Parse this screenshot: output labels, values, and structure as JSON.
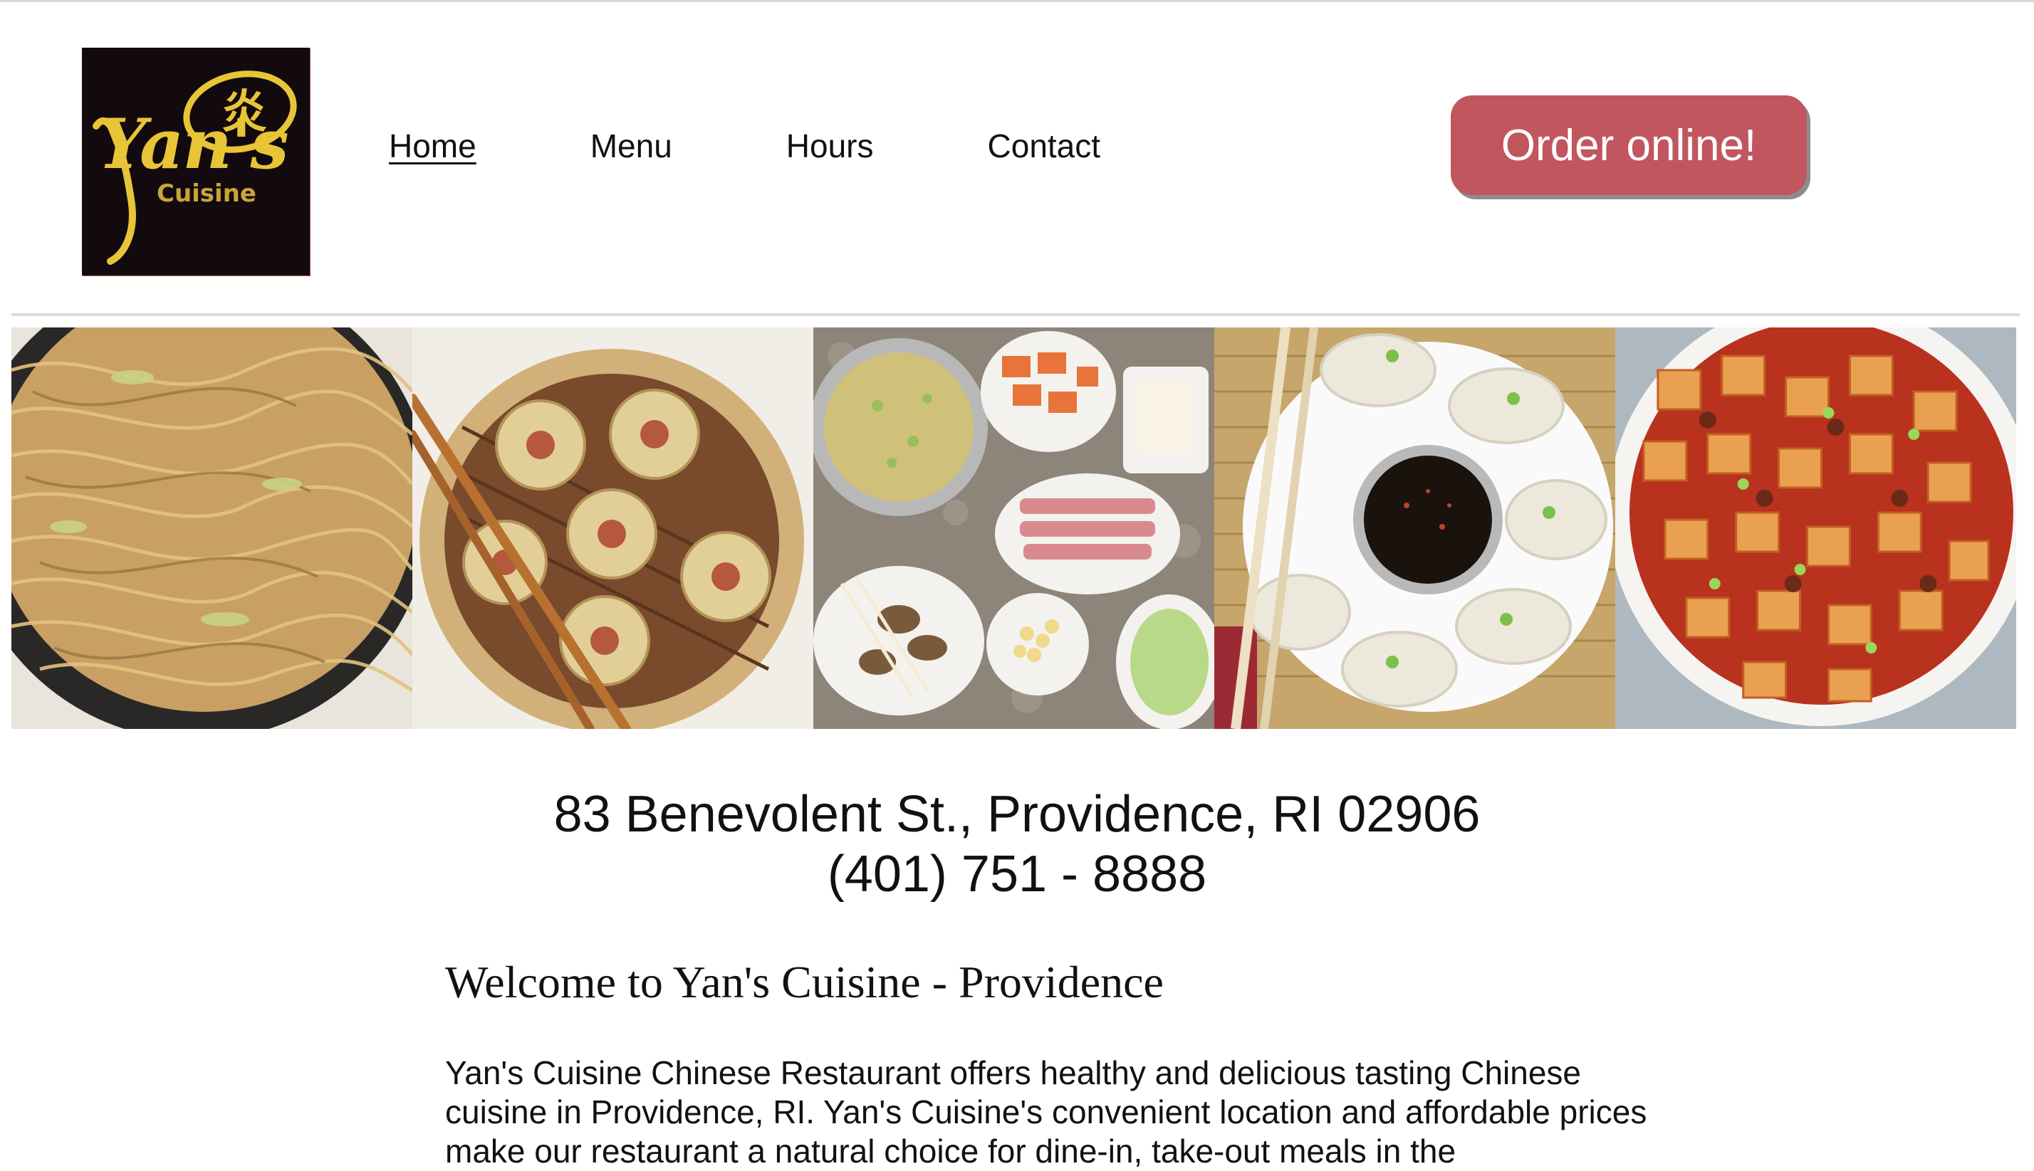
{
  "logo": {
    "brand_text": "Yan's",
    "sub_text": "Cuisine",
    "mark_text": "炎"
  },
  "nav": {
    "items": [
      {
        "label": "Home",
        "active": true
      },
      {
        "label": "Menu",
        "active": false
      },
      {
        "label": "Hours",
        "active": false
      },
      {
        "label": "Contact",
        "active": false
      }
    ]
  },
  "order_button": {
    "label": "Order online!",
    "color": "#c1565f"
  },
  "photos": [
    {
      "subject": "lo mein noodles"
    },
    {
      "subject": "steamed shumai dumplings"
    },
    {
      "subject": "hot pot ingredients"
    },
    {
      "subject": "boiled dumplings with dipping sauce"
    },
    {
      "subject": "mapo tofu"
    }
  ],
  "address": {
    "street": "83 Benevolent St., Providence, RI 02906",
    "phone": "(401) 751 - 8888"
  },
  "welcome": {
    "heading": "Welcome to Yan's Cuisine - Providence",
    "body": "Yan's Cuisine Chinese Restaurant offers healthy and delicious tasting Chinese cuisine in Providence, RI. Yan's Cuisine's convenient location and affordable prices make our restaurant a natural choice for dine-in, take-out meals in the"
  },
  "colors": {
    "accent": "#c1565f",
    "logo_bg": "#120a0e",
    "logo_gold": "#e8c437"
  }
}
